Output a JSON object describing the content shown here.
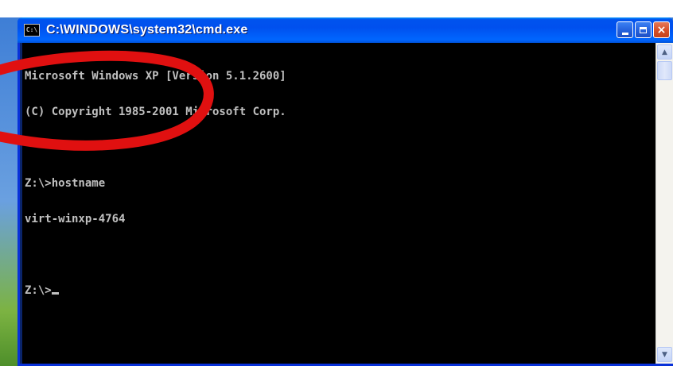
{
  "window": {
    "title": "C:\\WINDOWS\\system32\\cmd.exe",
    "icon_label": "C:\\",
    "controls": {
      "minimize": "minimize-icon",
      "maximize": "maximize-icon",
      "close_label": "×"
    }
  },
  "console": {
    "lines": [
      "Microsoft Windows XP [Version 5.1.2600]",
      "(C) Copyright 1985-2001 Microsoft Corp.",
      "",
      "Z:\\>hostname",
      "virt-winxp-4764",
      "",
      "Z:\\>"
    ]
  },
  "scrollbar": {
    "up_arrow": "▲",
    "down_arrow": "▼"
  },
  "colors": {
    "console_bg": "#000000",
    "console_fg": "#c0c0c0",
    "titlebar": "#0053ee",
    "annotation_circle": "#e01010"
  }
}
